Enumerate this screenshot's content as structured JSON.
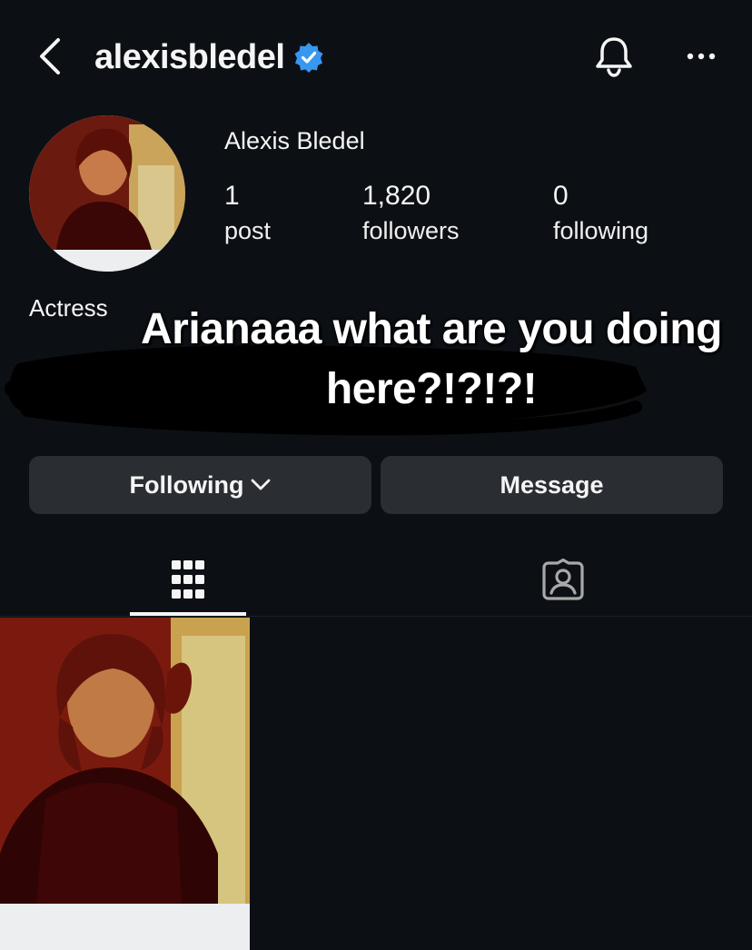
{
  "header": {
    "back_icon": "chevron-left-icon",
    "username": "alexisbledel",
    "verified_icon": "verified-badge-icon",
    "bell_icon": "bell-icon",
    "more_icon": "more-horizontal-icon"
  },
  "profile": {
    "display_name": "Alexis Bledel",
    "bio": "Actress",
    "stats": [
      {
        "count": "1",
        "label": "post"
      },
      {
        "count": "1,820",
        "label": "followers"
      },
      {
        "count": "0",
        "label": "following"
      }
    ]
  },
  "overlay": {
    "text": "Arianaaa what are you doing here?!?!?!"
  },
  "buttons": {
    "following_label": "Following",
    "message_label": "Message"
  },
  "tabs": [
    {
      "icon": "grid-icon",
      "active": true
    },
    {
      "icon": "tagged-person-icon",
      "active": false
    }
  ],
  "colors": {
    "background": "#0c1014",
    "button_bg": "#2a2e33",
    "verified_blue": "#3897f0",
    "text": "#f5f5f5"
  }
}
